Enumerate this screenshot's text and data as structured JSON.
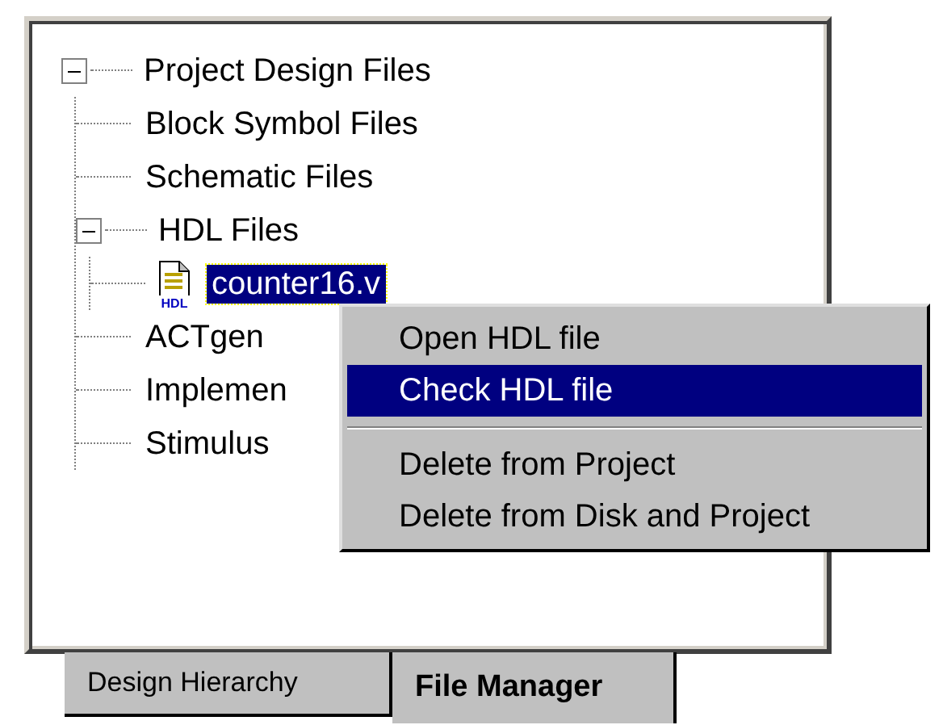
{
  "tree": [
    {
      "label": "Project Design Files",
      "expanded": true,
      "children": [
        {
          "label": "Block Symbol Files"
        },
        {
          "label": "Schematic Files"
        },
        {
          "label": "HDL Files",
          "expanded": true,
          "children": [
            {
              "label": "counter16.v",
              "kind": "hdl",
              "icon_text": "HDL",
              "selected": true
            }
          ]
        },
        {
          "label": "ACTgen"
        },
        {
          "label": "Implemen"
        },
        {
          "label": "Stimulus"
        }
      ]
    }
  ],
  "context_menu": [
    {
      "kind": "item",
      "label": "Open HDL file",
      "selected": false
    },
    {
      "kind": "item",
      "label": "Check HDL file",
      "selected": true
    },
    {
      "kind": "separator"
    },
    {
      "kind": "item",
      "label": "Delete from Project",
      "selected": false
    },
    {
      "kind": "item",
      "label": "Delete from Disk and Project",
      "selected": false
    }
  ],
  "tabs": [
    {
      "label": "Design Hierarchy",
      "selected": false
    },
    {
      "label": "File Manager",
      "selected": true
    }
  ]
}
